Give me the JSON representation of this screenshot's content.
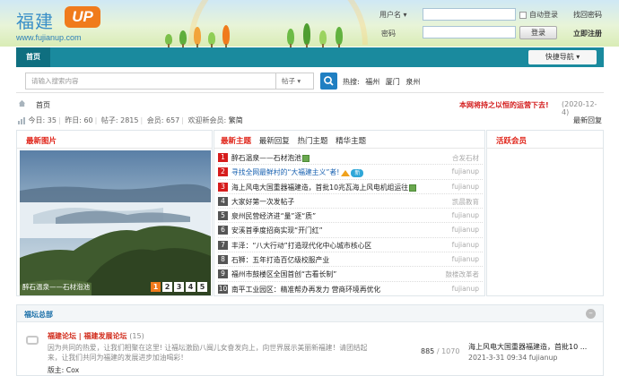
{
  "header": {
    "logo_cn": "福建",
    "logo_up": "UP",
    "url": "www.fujianup.com",
    "login": {
      "username_label": "用户名 ▾",
      "password_label": "密码",
      "auto_login": "自动登录",
      "retrieve_password": "找回密码",
      "login_button": "登录",
      "register": "立即注册"
    }
  },
  "nav": {
    "home": "首页",
    "quick_nav": "快捷导航 ▾"
  },
  "search": {
    "placeholder": "请输入搜索内容",
    "type": "帖子 ▾",
    "hot_label": "热搜:",
    "hot_terms": [
      "福州",
      "厦门",
      "泉州"
    ]
  },
  "breadcrumb": {
    "current": "首页"
  },
  "notice": {
    "text": "本网将持之以恒的运营下去!",
    "date": "(2020-12-4)"
  },
  "stats": {
    "today": "今日: 35",
    "yesterday": "昨日: 60",
    "posts": "帖子: 2815",
    "members": "会员: 657",
    "welcome": "欢迎新会员:",
    "new_member": "繁简",
    "latest_reply": "最新回复"
  },
  "latest_images": {
    "title": "最新图片",
    "caption": "醉石温泉——石材泡池",
    "pages": [
      "1",
      "2",
      "3",
      "4",
      "5"
    ],
    "active_page": "1"
  },
  "topics": {
    "tabs": [
      "最新主题",
      "最新回复",
      "热门主题",
      "精华主题"
    ],
    "rows": [
      {
        "num": "1",
        "title": "醉石温泉——石材泡池",
        "author": "合发石材",
        "style": "plain",
        "icon": "image"
      },
      {
        "num": "2",
        "title": "寻找全网最鲜村的“大福建主义”者!",
        "author": "fujianup",
        "style": "blue",
        "icon": "hot-new"
      },
      {
        "num": "3",
        "title": "海上风电大国重器福建造，首批10兆瓦海上风电机组运往",
        "author": "fujianup",
        "style": "plain",
        "icon": "image"
      },
      {
        "num": "4",
        "title": "大家好第一次发帖子",
        "author": "凯晨教育",
        "style": "plain",
        "icon": ""
      },
      {
        "num": "5",
        "title": "泉州民营经济进“量”逐“质”",
        "author": "fujianup",
        "style": "plain",
        "icon": ""
      },
      {
        "num": "6",
        "title": "安溪首季度招商实现“开门红”",
        "author": "fujianup",
        "style": "plain",
        "icon": ""
      },
      {
        "num": "7",
        "title": "丰泽：“八大行动”打造现代化中心城市核心区",
        "author": "fujianup",
        "style": "plain",
        "icon": ""
      },
      {
        "num": "8",
        "title": "石狮：五年打造百亿级校服产业",
        "author": "fujianup",
        "style": "plain",
        "icon": ""
      },
      {
        "num": "9",
        "title": "福州市鼓楼区全国首创“古看长制”",
        "author": "鼓楼改革者",
        "style": "plain",
        "icon": ""
      },
      {
        "num": "10",
        "title": "南平工业园区：精准帮办再发力 营商环境再优化",
        "author": "fujianup",
        "style": "plain",
        "icon": ""
      }
    ]
  },
  "active_members": {
    "title": "活跃会员"
  },
  "forum_section": {
    "title": "福坛总部",
    "forum_name": "福建论坛 | 福建发展论坛",
    "forum_count": "(15)",
    "description": "因为共同的热爱，让我们相聚在这里! 让福坛激励八闽儿女奋发向上，向世界展示美丽新福建！请团结起来，让我们共同为福建的发展进步加油喝彩！",
    "moderator": "版主: Cox",
    "threads": "885",
    "posts": "1070",
    "last_post_title": "海上风电大国重器福建造，首批10 ...",
    "last_post_meta": "2021-3-31 09:34 fujianup"
  }
}
